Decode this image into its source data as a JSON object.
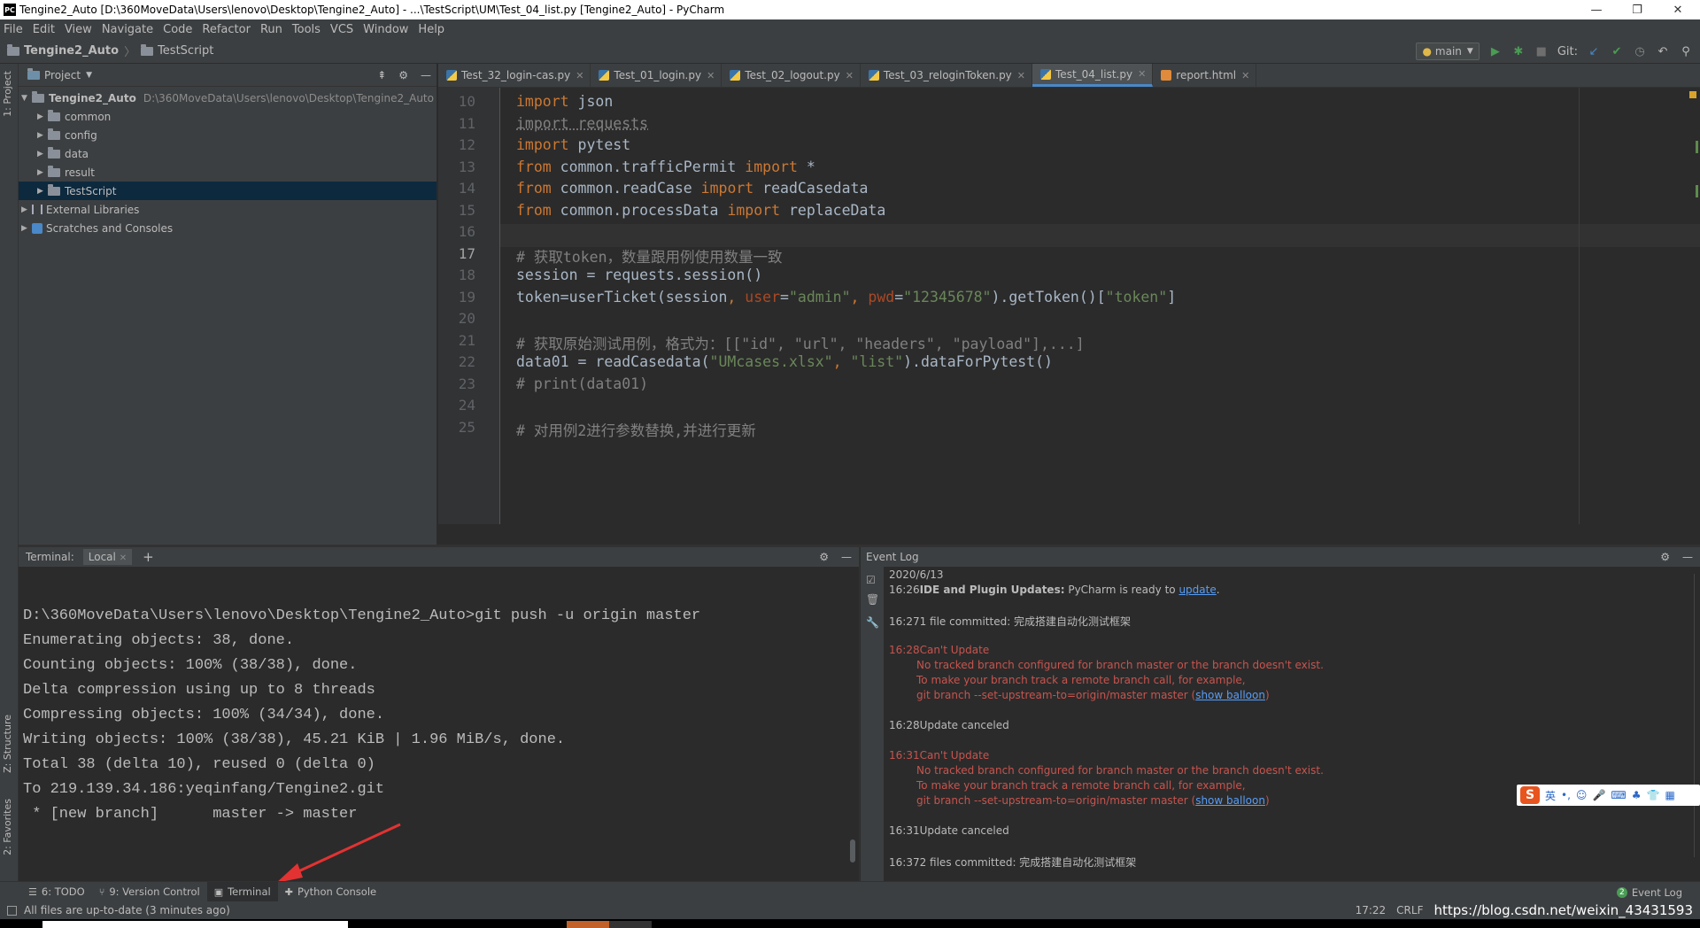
{
  "window": {
    "title": "Tengine2_Auto [D:\\360MoveData\\Users\\lenovo\\Desktop\\Tengine2_Auto] - ...\\TestScript\\UM\\Test_04_list.py [Tengine2_Auto] - PyCharm",
    "app_icon": "PC",
    "controls": [
      "—",
      "❐",
      "✕"
    ]
  },
  "menu": [
    "File",
    "Edit",
    "View",
    "Navigate",
    "Code",
    "Refactor",
    "Run",
    "Tools",
    "VCS",
    "Window",
    "Help"
  ],
  "breadcrumb": [
    "Tengine2_Auto",
    "TestScript"
  ],
  "toolbar": {
    "branch": "main",
    "git_label": "Git:"
  },
  "sidebar_tabs": {
    "project": "1: Project",
    "structure": "Z: Structure",
    "favorites": "2: Favorites"
  },
  "project_panel": {
    "title": "Project",
    "root": {
      "name": "Tengine2_Auto",
      "path": "D:\\360MoveData\\Users\\lenovo\\Desktop\\Tengine2_Auto"
    },
    "folders": [
      "common",
      "config",
      "data",
      "result",
      "TestScript"
    ],
    "extras": [
      "External Libraries",
      "Scratches and Consoles"
    ]
  },
  "tabs": [
    {
      "label": "Test_32_login-cas.py",
      "type": "py"
    },
    {
      "label": "Test_01_login.py",
      "type": "py"
    },
    {
      "label": "Test_02_logout.py",
      "type": "py"
    },
    {
      "label": "Test_03_reloginToken.py",
      "type": "py"
    },
    {
      "label": "Test_04_list.py",
      "type": "py",
      "active": true
    },
    {
      "label": "report.html",
      "type": "html"
    }
  ],
  "editor": {
    "current_line": "17",
    "line_numbers": [
      "10",
      "11",
      "12",
      "13",
      "14",
      "15",
      "16",
      "17",
      "18",
      "19",
      "20",
      "21",
      "22",
      "23",
      "24",
      "25"
    ]
  },
  "terminal": {
    "label": "Terminal:",
    "tab": "Local",
    "lines": [
      "D:\\360MoveData\\Users\\lenovo\\Desktop\\Tengine2_Auto>git push -u origin master",
      "Enumerating objects: 38, done.",
      "Counting objects: 100% (38/38), done.",
      "Delta compression using up to 8 threads",
      "Compressing objects: 100% (34/34), done.",
      "Writing objects: 100% (38/38), 45.21 KiB | 1.96 MiB/s, done.",
      "Total 38 (delta 10), reused 0 (delta 0)",
      "To 219.139.34.186:yeqinfang/Tengine2.git",
      " * [new branch]      master -> master"
    ]
  },
  "event_log": {
    "title": "Event Log",
    "date": "2020/6/13",
    "e1_time": "16:26",
    "e1_title": "IDE and Plugin Updates:",
    "e1_text": " PyCharm is ready to ",
    "e1_link": "update",
    "e2_time": "16:27",
    "e2_text": "1 file committed: 完成搭建自动化测试框架",
    "e3_time": "16:28",
    "e3_title": "Can't Update",
    "err1": "No tracked branch configured for branch master or the branch doesn't exist.",
    "err2": "To make your branch track a remote branch call, for example,",
    "err3": "git branch --set-upstream-to=origin/master master (",
    "show_balloon": "show balloon",
    "close_paren": ")",
    "e4_time": "16:28",
    "e4_text": "Update canceled",
    "e5_time": "16:31",
    "e5_title": "Can't Update",
    "e6_time": "16:31",
    "e6_text": "Update canceled",
    "e7_time": "16:37",
    "e7_text": "2 files committed: 完成搭建自动化测试框架"
  },
  "ime": {
    "logo": "S",
    "lang": "英"
  },
  "bottom_tools": [
    {
      "label": "6: TODO"
    },
    {
      "label": "9: Version Control"
    },
    {
      "label": "Terminal",
      "active": true
    },
    {
      "label": "Python Console"
    }
  ],
  "event_log_button": {
    "label": "Event Log",
    "count": "2"
  },
  "status": {
    "message": "All files are up-to-date (3 minutes ago)",
    "position": "17:22",
    "line_sep": "CRLF",
    "watermark": "https://blog.csdn.net/weixin_43431593"
  }
}
